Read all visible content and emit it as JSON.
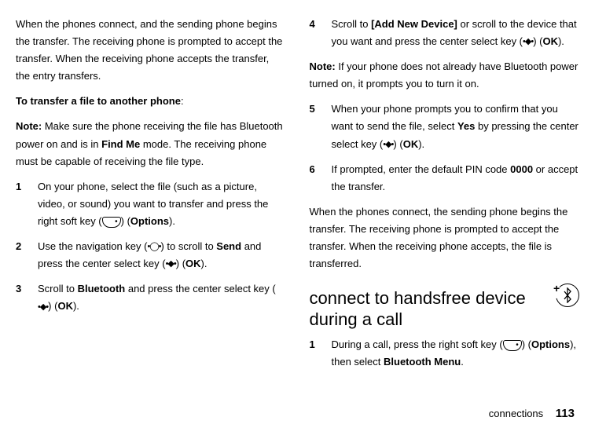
{
  "left": {
    "intro": "When the phones connect, and the sending phone begins the transfer. The receiving phone is prompted to accept the transfer. When the receiving phone accepts the transfer, the entry transfers.",
    "transfer_heading": "To transfer a file to another phone",
    "note_label": "Note:",
    "note_text_a": " Make sure the phone receiving the file has Bluetooth power on and is in ",
    "findme": "Find Me",
    "note_text_b": " mode. The receiving phone must be capable of receiving the file type.",
    "step1_a": "On your phone, select the file (such as a picture, video, or sound) you want to transfer and press the right soft key (",
    "step1_b": ") (",
    "options": "Options",
    "step1_c": ").",
    "step2_a": "Use the navigation key (",
    "step2_b": ") to scroll to ",
    "send": "Send",
    "step2_c": " and press the center select key (",
    "step2_d": ") (",
    "ok": "OK",
    "step2_e": ").",
    "step3_a": "Scroll to ",
    "bluetooth": "Bluetooth",
    "step3_b": " and press the center select key (",
    "step3_c": ") (",
    "step3_d": ")."
  },
  "right": {
    "step4_a": "Scroll to ",
    "add_new": "[Add New Device]",
    "step4_b": " or scroll to the device that you want and press the center select key (",
    "step4_c": ") (",
    "ok": "OK",
    "step4_d": ").",
    "note_label": "Note:",
    "note_text": " If your phone does not already have Bluetooth power turned on, it prompts you to turn it on.",
    "step5_a": "When your phone prompts you to confirm that you want to send the file, select ",
    "yes": "Yes",
    "step5_b": " by pressing the center select key (",
    "step5_c": ") (",
    "step5_d": ").",
    "step6_a": "If prompted, enter the default PIN code ",
    "pin": "0000",
    "step6_b": " or accept the transfer.",
    "closing": "When the phones connect, the sending phone begins the transfer. The receiving phone is prompted to accept the transfer. When the receiving phone accepts, the file is transferred.",
    "subheading": "connect to handsfree device during a call",
    "hf1_a": "During a call, press the right soft key (",
    "hf1_b": ") (",
    "options": "Options",
    "hf1_c": "), then select ",
    "btmenu": "Bluetooth Menu",
    "hf1_d": "."
  },
  "footer": {
    "section": "connections",
    "page": "113"
  }
}
